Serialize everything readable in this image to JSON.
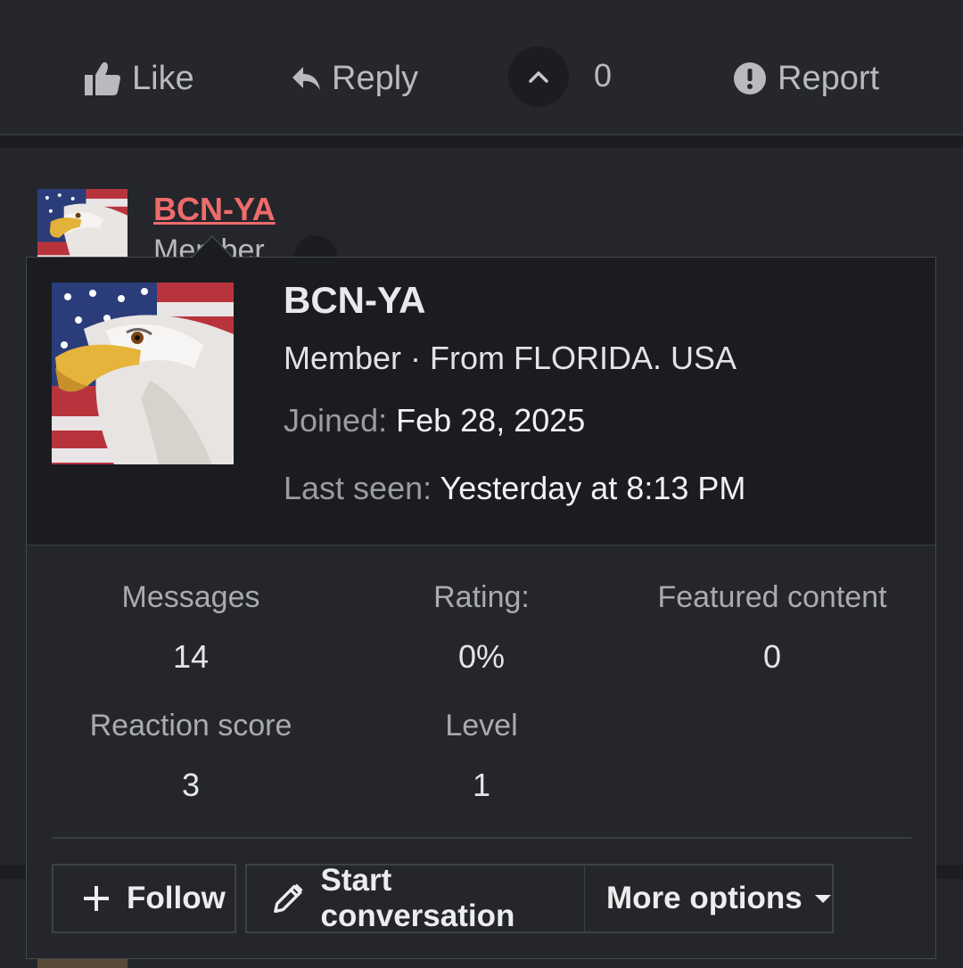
{
  "actions": {
    "like_label": "Like",
    "reply_label": "Reply",
    "vote_count": "0",
    "report_label": "Report"
  },
  "post": {
    "username": "BCN-YA",
    "role_partial": "Member"
  },
  "card": {
    "username": "BCN-YA",
    "role_location": "Member · From FLORIDA. USA",
    "joined_label": "Joined:",
    "joined_value": "Feb 28, 2025",
    "last_seen_label": "Last seen:",
    "last_seen_value": "Yesterday at 8:13 PM",
    "stats": {
      "messages_label": "Messages",
      "messages_value": "14",
      "rating_label": "Rating:",
      "rating_value": "0%",
      "featured_label": "Featured content",
      "featured_value": "0",
      "reaction_label": "Reaction score",
      "reaction_value": "3",
      "level_label": "Level",
      "level_value": "1"
    },
    "buttons": {
      "follow": "Follow",
      "start_conversation": "Start conversation",
      "more_options": "More options"
    }
  },
  "icons": {
    "like": "thumbs-up-icon",
    "reply": "reply-arrow-icon",
    "vote": "chevron-up-icon",
    "report": "exclamation-circle-icon",
    "follow": "plus-icon",
    "conversation": "pencil-icon",
    "more": "caret-down-icon"
  },
  "colors": {
    "background": "#24262b",
    "card_header": "#1b1c20",
    "username_link": "#ef6b6b",
    "muted_text": "#9a9ca0"
  }
}
